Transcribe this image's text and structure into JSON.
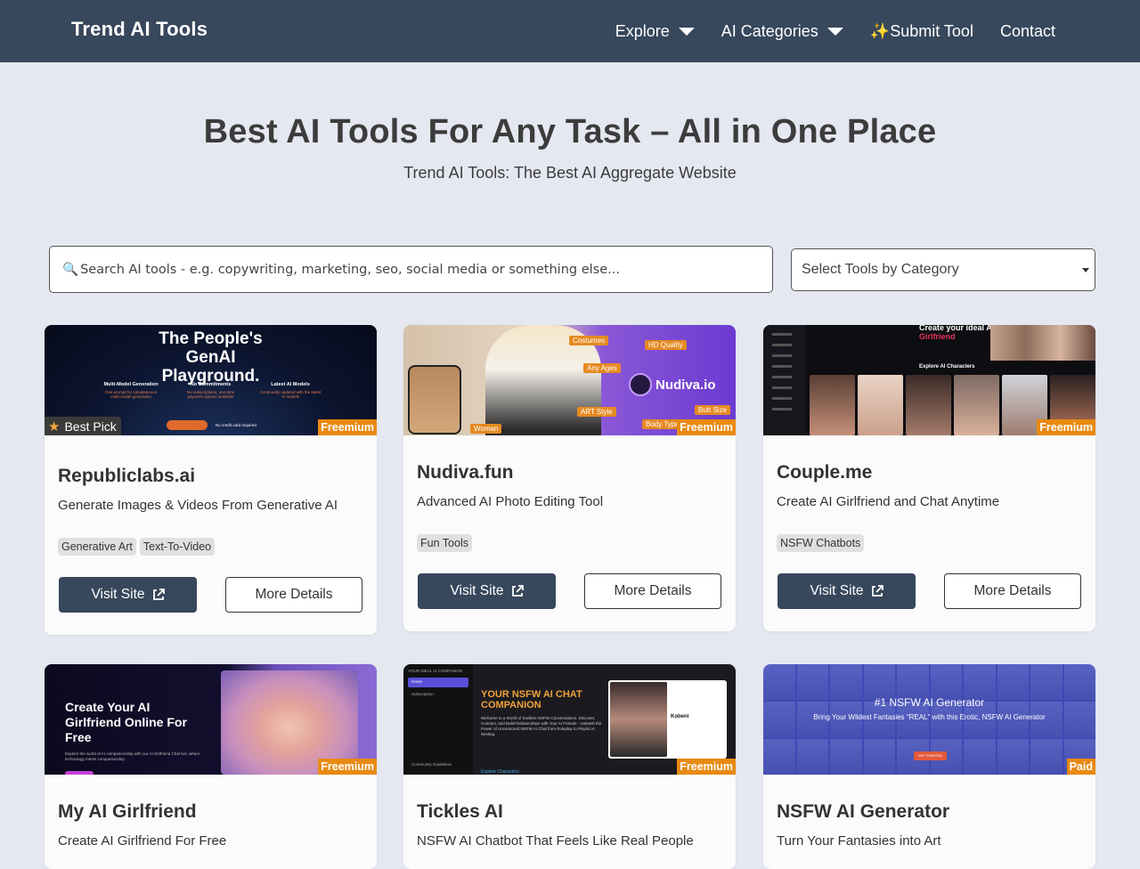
{
  "nav": {
    "brand": "Trend AI Tools",
    "links": [
      {
        "label": "Explore"
      },
      {
        "label": "AI Categories"
      },
      {
        "label": "✨Submit Tool"
      },
      {
        "label": "Contact"
      }
    ]
  },
  "hero": {
    "title": "Best AI Tools For Any Task – All in One Place",
    "subtitle": "Trend AI Tools: The Best AI Aggregate Website"
  },
  "search": {
    "placeholder": "Search AI tools - e.g. copywriting, marketing, seo, social media or something else...",
    "icon": "magnifier-icon",
    "category_select": "Select Tools by Category"
  },
  "labels": {
    "visit": "Visit Site",
    "more": "More Details",
    "best_pick": "Best Pick"
  },
  "colors": {
    "navbar": "#37475c",
    "badge": "#e88a12",
    "page_bg": "#e5e8f1"
  },
  "cards": [
    {
      "title": "Republiclabs.ai",
      "desc": "Generate Images & Videos From Generative AI",
      "pricing": "Freemium",
      "tags": [
        "Generative Art",
        "Text-To-Video"
      ],
      "best_pick": true,
      "thumb": {
        "headline": "The People's GenAI Playground.",
        "col1": "Multi-Model Generation",
        "col1_sub": "One prompt for simultaneous multi-model generation",
        "col2": "No Commitments",
        "col2_sub": "No subscriptions; one-time payment options available",
        "col3": "Latest AI Models",
        "col3_sub": "Continually updated with the latest AI models",
        "note": "No credit card required"
      }
    },
    {
      "title": "Nudiva.fun",
      "desc": "Advanced AI Photo Editing Tool",
      "pricing": "Freemium",
      "tags": [
        "Fun Tools"
      ],
      "best_pick": false,
      "thumb": {
        "logo": "Nudiva.io",
        "l1": "Costumes",
        "l2": "HD Quality",
        "l3": "Any Ages",
        "l4": "ART Style",
        "l5": "Butt Size",
        "l6": "Body Type",
        "l7": "Woman"
      }
    },
    {
      "title": "Couple.me",
      "desc": "Create AI Girlfriend and Chat Anytime",
      "pricing": "Freemium",
      "tags": [
        "NSFW Chatbots"
      ],
      "best_pick": false,
      "thumb": {
        "headline": "Create your ideal AI",
        "headline2": "Girlfriend",
        "explore": "Explore AI Characters"
      }
    },
    {
      "title": "My AI Girlfriend",
      "desc": "Create AI Girlfriend For Free",
      "pricing": "Freemium",
      "tags": [],
      "best_pick": false,
      "thumb": {
        "headline": "Create Your AI Girlfriend Online For Free",
        "sub": "Explore the world of AI companionship with our AI Girlfriend Chat bot, where technology meets companionship."
      }
    },
    {
      "title": "Tickles AI",
      "desc": "NSFW AI Chatbot That Feels Like Real People",
      "pricing": "Freemium",
      "tags": [],
      "best_pick": false,
      "thumb": {
        "brand": "YOUR IDEAL AI COMPANION",
        "home": "Home",
        "subscription": "Subscription",
        "community": "Community Guidelines",
        "headline": "YOUR NSFW AI CHAT COMPANION",
        "body": "Welcome to a World of Endless NSFW Conversations. Discover, Connect, and Build Relationships with Your AI Friends - Unleash the Power of Uncensored NSFW AI Chat from Roleplay to Playful AI Sexting.",
        "explore": "Explore Characters",
        "char": "Kobeni"
      }
    },
    {
      "title": "NSFW AI Generator",
      "desc": "Turn Your Fantasies into Art",
      "pricing": "Paid",
      "tags": [],
      "best_pick": false,
      "thumb": {
        "headline": "#1 NSFW AI Generator",
        "sub": "Bring Your Wildest Fantasies \"REAL\" with this Erotic, NSFW AI Generator",
        "cta": "GET STARTED"
      }
    }
  ]
}
